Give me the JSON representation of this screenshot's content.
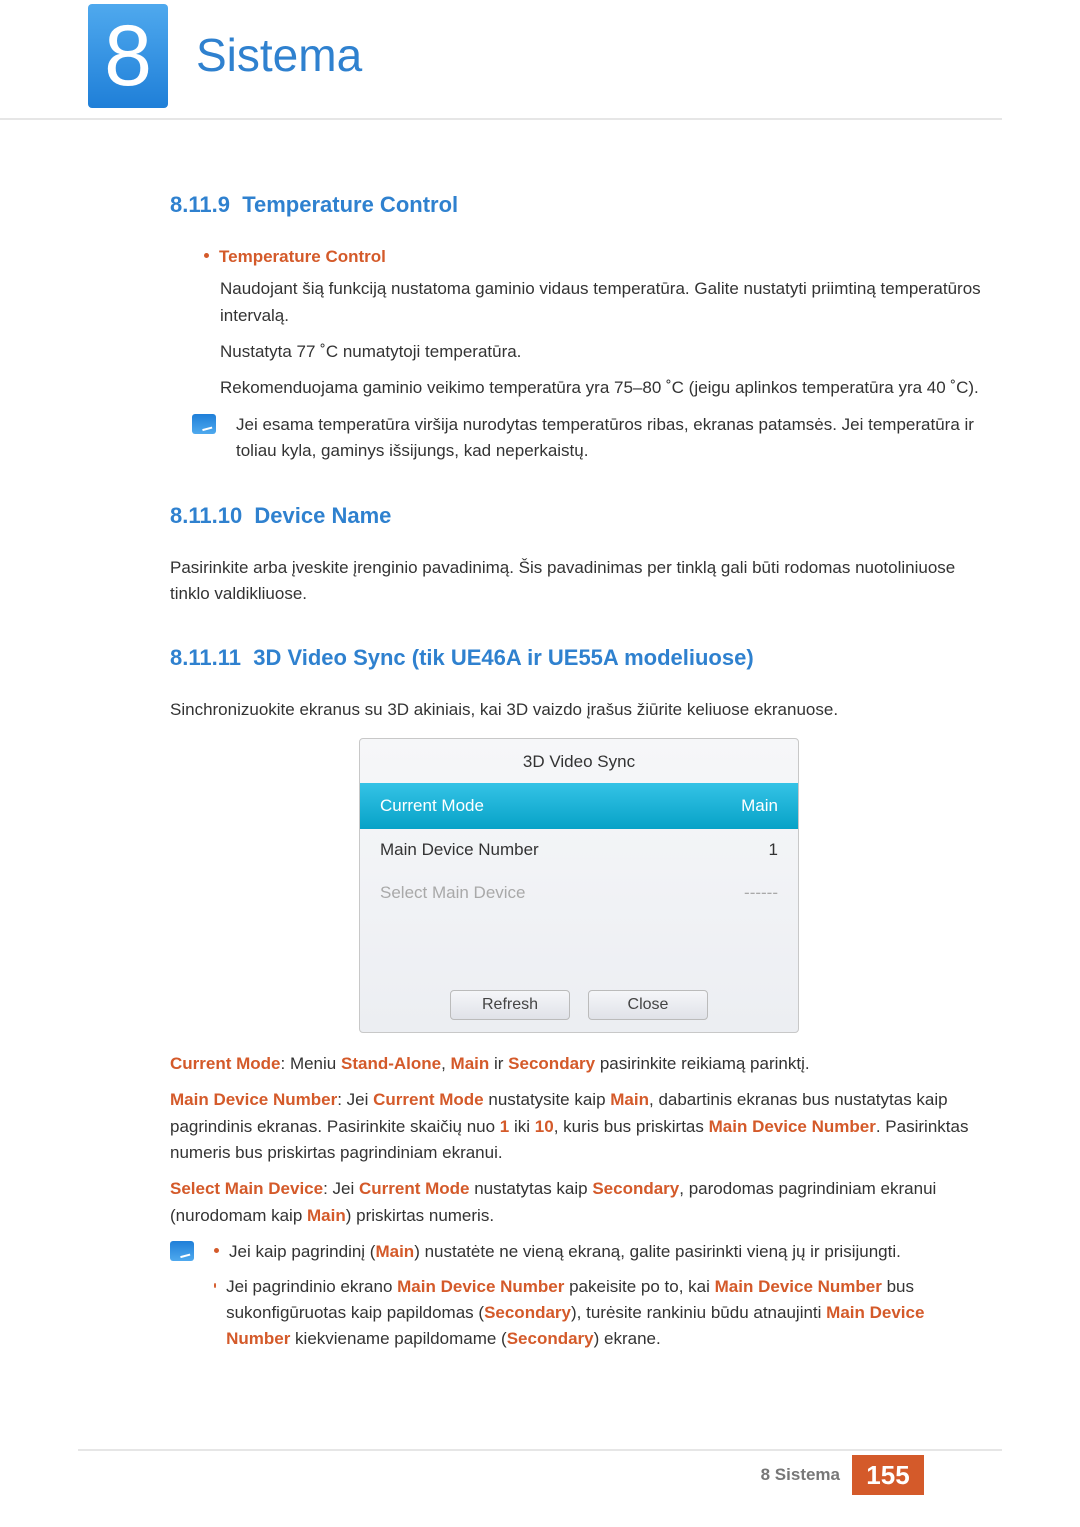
{
  "header": {
    "chapter_number": "8",
    "chapter_title": "Sistema"
  },
  "sections": {
    "s9": {
      "number": "8.11.9",
      "title": "Temperature Control",
      "bullet_label": "Temperature Control",
      "p1": "Naudojant šią funkciją nustatoma gaminio vidaus temperatūra. Galite nustatyti priimtiną temperatūros intervalą.",
      "p2": "Nustatyta 77 ˚C numatytoji temperatūra.",
      "p3": "Rekomenduojama gaminio veikimo temperatūra yra 75–80 ˚C (jeigu aplinkos temperatūra yra 40 ˚C).",
      "note": "Jei esama temperatūra viršija nurodytas temperatūros ribas, ekranas patamsės. Jei temperatūra ir toliau kyla, gaminys išsijungs, kad neperkaistų."
    },
    "s10": {
      "number": "8.11.10",
      "title": "Device Name",
      "p1": "Pasirinkite arba įveskite įrenginio pavadinimą. Šis pavadinimas per tinklą gali būti rodomas nuotoliniuose tinklo valdikliuose."
    },
    "s11": {
      "number": "8.11.11",
      "title": "3D Video Sync (tik UE46A ir UE55A modeliuose)",
      "p1": "Sinchronizuokite ekranus su 3D akiniais, kai 3D vaizdo įrašus žiūrite keliuose ekranuose.",
      "menu": {
        "title": "3D Video Sync",
        "rows": [
          {
            "label": "Current Mode",
            "value": "Main",
            "selected": true
          },
          {
            "label": "Main Device Number",
            "value": "1"
          },
          {
            "label": "Select Main Device",
            "value": "------",
            "disabled": true
          }
        ],
        "buttons": {
          "refresh": "Refresh",
          "close": "Close"
        }
      },
      "def": {
        "cm_label": "Current Mode",
        "cm_text_a": ": Meniu ",
        "cm_sa": "Stand-Alone",
        "cm_text_b": ", ",
        "cm_main": "Main",
        "cm_text_c": " ir ",
        "cm_sec": "Secondary",
        "cm_text_d": " pasirinkite reikiamą parinktį.",
        "mdn_label": "Main Device Number",
        "mdn_a": ": Jei ",
        "mdn_cm": "Current Mode",
        "mdn_b": " nustatysite kaip ",
        "mdn_main": "Main",
        "mdn_c": ", dabartinis ekranas bus nustatytas kaip pagrindinis ekranas. Pasirinkite skaičių nuo ",
        "mdn_one": "1",
        "mdn_d": " iki ",
        "mdn_ten": "10",
        "mdn_e": ", kuris bus priskirtas ",
        "mdn_lbl2": "Main Device Number",
        "mdn_f": ". Pasirinktas numeris bus priskirtas pagrindiniam ekranui.",
        "smd_label": "Select Main Device",
        "smd_a": ": Jei ",
        "smd_cm": "Current Mode",
        "smd_b": " nustatytas kaip ",
        "smd_sec": "Secondary",
        "smd_c": ", parodomas pagrindiniam ekranui (nurodomam kaip ",
        "smd_main": "Main",
        "smd_d": ") priskirtas numeris."
      },
      "notes": {
        "n1_a": "Jei kaip pagrindinį (",
        "n1_main": "Main",
        "n1_b": ") nustatėte ne vieną ekraną, galite pasirinkti vieną jų ir prisijungti.",
        "n2_a": "Jei pagrindinio ekrano ",
        "n2_mdn": "Main Device Number",
        "n2_b": " pakeisite po to, kai ",
        "n2_mdn2": "Main Device Number",
        "n2_c": " bus sukonfigūruotas kaip papildomas (",
        "n2_sec": "Secondary",
        "n2_d": "), turėsite rankiniu būdu atnaujinti ",
        "n2_mdn3": "Main Device Number",
        "n2_e": " kiekviename papildomame (",
        "n2_sec2": "Secondary",
        "n2_f": ") ekrane."
      }
    }
  },
  "footer": {
    "breadcrumb_num": "8",
    "breadcrumb_title": "Sistema",
    "page": "155"
  }
}
